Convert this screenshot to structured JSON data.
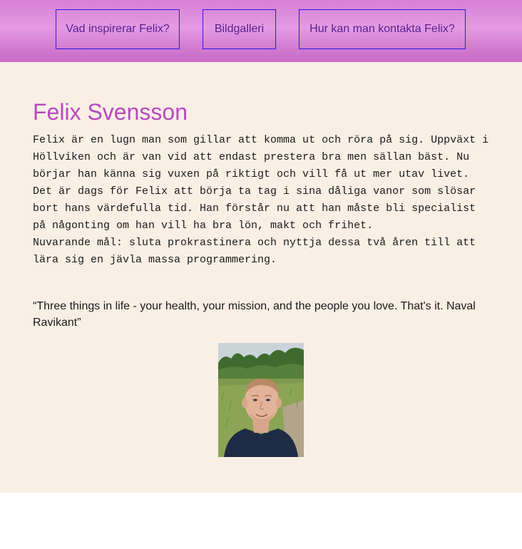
{
  "nav": {
    "items": [
      {
        "label": "Vad inspirerar Felix?"
      },
      {
        "label": "Bildgalleri"
      },
      {
        "label": "Hur kan man kontakta Felix?"
      }
    ]
  },
  "main": {
    "title": "Felix Svensson",
    "bio_paragraph": "Felix är en lugn man som gillar att komma ut och röra på sig. Uppväxt i Höllviken och är van vid att endast prestera bra men sällan bäst. Nu börjar han känna sig vuxen på riktigt och vill få ut mer utav livet. Det är dags för Felix att börja ta tag i sina dåliga vanor som slösar bort hans värdefulla tid. Han förstår nu att han måste bli specialist på någonting om han vill ha bra lön, makt och frihet.",
    "bio_goal": "Nuvarande mål: sluta prokrastinera och nyttja dessa två åren till att lära sig en jävla massa programmering.",
    "quote": "“Three things in life - your health, your mission, and the people you love. That's it. Naval Ravikant”"
  },
  "colors": {
    "nav_gradient": "#d77fd6",
    "nav_border": "#2d18e8",
    "nav_text": "#5a1f90",
    "content_bg": "#faefe5",
    "title": "#b64bbd"
  }
}
